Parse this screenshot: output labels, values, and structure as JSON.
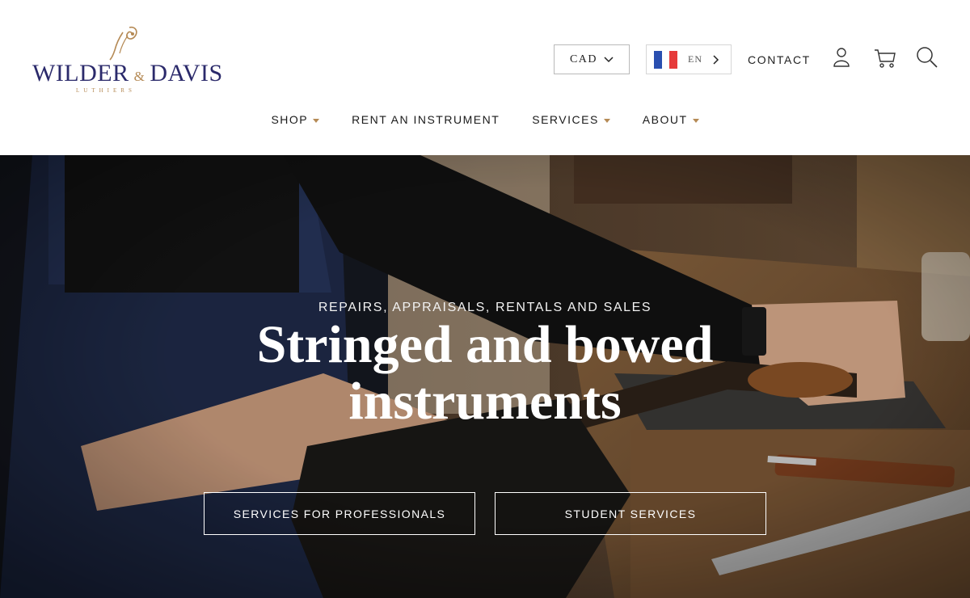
{
  "brand": {
    "name_left": "WILDER",
    "ampersand": "&",
    "name_right": "DAVIS",
    "tagline": "LUTHIERS"
  },
  "utility": {
    "currency": "CAD",
    "language": "EN",
    "contact": "CONTACT",
    "icons": [
      "user-icon",
      "cart-icon",
      "search-icon"
    ]
  },
  "nav": {
    "items": [
      {
        "label": "SHOP",
        "dropdown": true
      },
      {
        "label": "RENT AN INSTRUMENT",
        "dropdown": false
      },
      {
        "label": "SERVICES",
        "dropdown": true
      },
      {
        "label": "ABOUT",
        "dropdown": true
      }
    ]
  },
  "hero": {
    "eyebrow": "REPAIRS, APPRAISALS, RENTALS AND SALES",
    "title": "Stringed and bowed instruments",
    "buttons": {
      "professionals": "SERVICES FOR PROFESSIONALS",
      "students": "STUDENT SERVICES"
    }
  },
  "colors": {
    "brand_navy": "#2b2a6b",
    "brand_gold": "#b58a55"
  }
}
